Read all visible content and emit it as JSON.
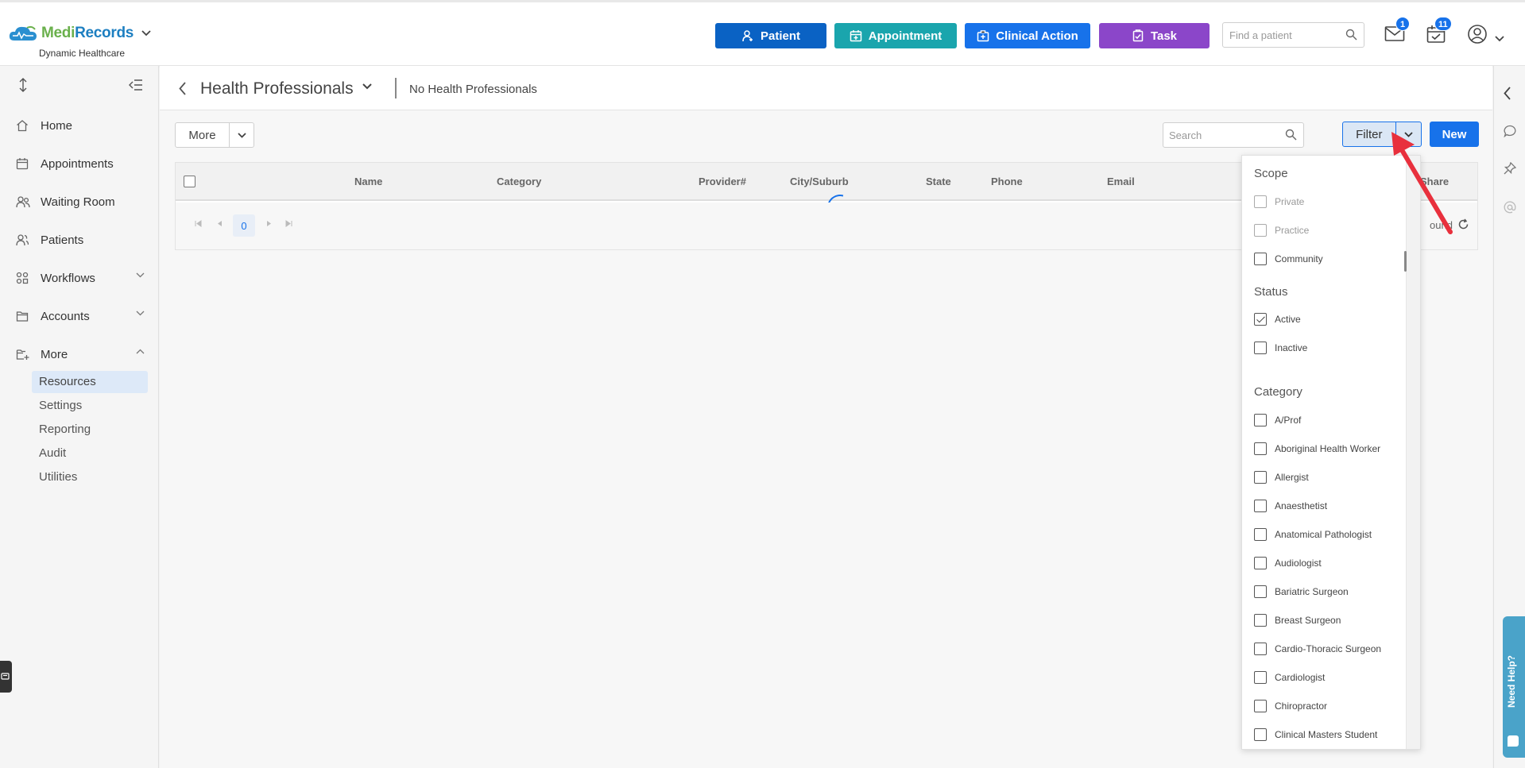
{
  "header": {
    "logo_part1": "Medi",
    "logo_part2": "Records",
    "practice": "Dynamic Healthcare",
    "buttons": {
      "patient": "Patient",
      "appointment": "Appointment",
      "clinical_action": "Clinical Action",
      "task": "Task"
    },
    "find_placeholder": "Find a patient",
    "mail_badge": "1",
    "tasks_badge": "11",
    "colors": {
      "patient": "#0a62c4",
      "appointment": "#1aa5ad",
      "clinical_action": "#1772ea",
      "task": "#8b46c9"
    }
  },
  "sidebar": {
    "items": [
      {
        "label": "Home",
        "icon": "home-icon"
      },
      {
        "label": "Appointments",
        "icon": "calendar-icon"
      },
      {
        "label": "Waiting Room",
        "icon": "people-icon"
      },
      {
        "label": "Patients",
        "icon": "users-icon"
      },
      {
        "label": "Workflows",
        "icon": "workflow-icon"
      },
      {
        "label": "Accounts",
        "icon": "folder-icon"
      },
      {
        "label": "More",
        "icon": "folder-plus-icon"
      }
    ],
    "sub_items": [
      "Resources",
      "Settings",
      "Reporting",
      "Audit",
      "Utilities"
    ],
    "active_sub": "Resources"
  },
  "page": {
    "title": "Health Professionals",
    "subtitle": "No Health Professionals",
    "more_label": "More",
    "search_placeholder": "Search",
    "filter_label": "Filter",
    "new_label": "New"
  },
  "grid": {
    "columns": [
      "Name",
      "Category",
      "Provider#",
      "City/Suburb",
      "State",
      "Phone",
      "Email",
      "Share"
    ],
    "page_number": "0",
    "pager_info": "ound"
  },
  "filter_panel": {
    "scope_title": "Scope",
    "scope": [
      {
        "label": "Private",
        "checked": false,
        "disabled": true
      },
      {
        "label": "Practice",
        "checked": false,
        "disabled": true
      },
      {
        "label": "Community",
        "checked": false,
        "disabled": false
      }
    ],
    "status_title": "Status",
    "status": [
      {
        "label": "Active",
        "checked": true
      },
      {
        "label": "Inactive",
        "checked": false
      }
    ],
    "category_title": "Category",
    "categories": [
      "A/Prof",
      "Aboriginal Health Worker",
      "Allergist",
      "Anaesthetist",
      "Anatomical Pathologist",
      "Audiologist",
      "Bariatric Surgeon",
      "Breast Surgeon",
      "Cardio-Thoracic Surgeon",
      "Cardiologist",
      "Chiropractor",
      "Clinical Masters Student"
    ]
  },
  "help": {
    "label": "Need Help?"
  }
}
